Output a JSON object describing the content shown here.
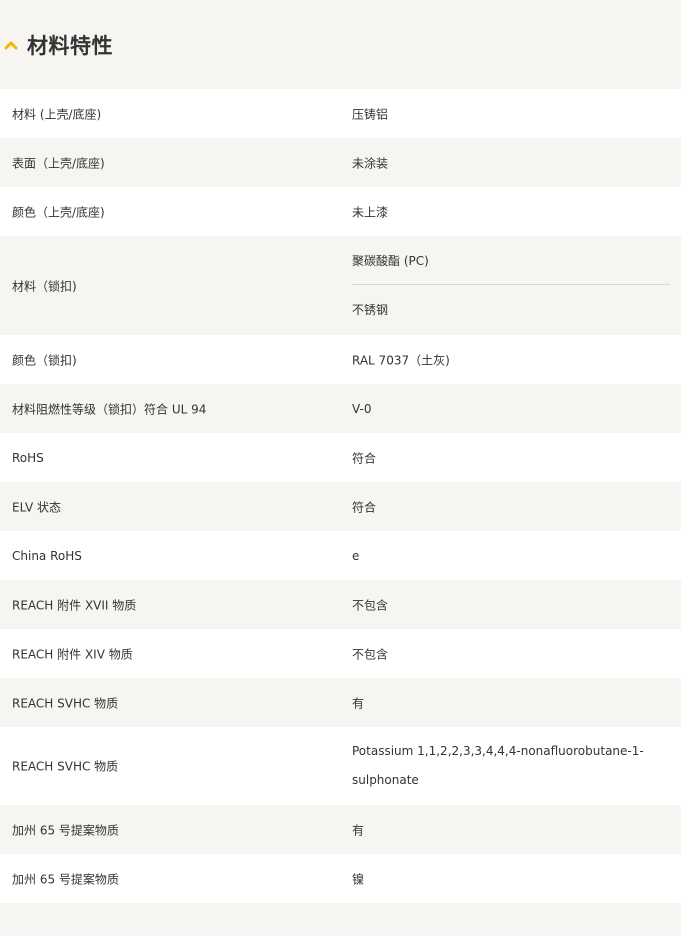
{
  "section": {
    "title": "材料特性",
    "icon": "chevron-up-icon",
    "accent_color": "#f5b800"
  },
  "rows": [
    {
      "label": "材料 (上壳/底座)",
      "value": "压铸铝"
    },
    {
      "label": "表面（上壳/底座)",
      "value": "未涂装"
    },
    {
      "label": "颜色（上壳/底座)",
      "value": "未上漆"
    },
    {
      "label": "材料（锁扣)",
      "values": [
        "聚碳酸酯 (PC)",
        "不锈钢"
      ]
    },
    {
      "label": "颜色（锁扣)",
      "value": "RAL 7037（土灰)"
    },
    {
      "label": "材料阻燃性等级（锁扣）符合 UL 94",
      "value": "V-0"
    },
    {
      "label": "RoHS",
      "value": "符合"
    },
    {
      "label": "ELV 状态",
      "value": "符合"
    },
    {
      "label": "China RoHS",
      "value": "e"
    },
    {
      "label": "REACH 附件 XVII 物质",
      "value": "不包含"
    },
    {
      "label": "REACH 附件 XIV 物质",
      "value": "不包含"
    },
    {
      "label": "REACH SVHC 物质",
      "value": "有"
    },
    {
      "label": "REACH SVHC 物质",
      "value": "Potassium 1,1,2,2,3,3,4,4,4-nonafluorobutane-1-sulphonate"
    },
    {
      "label": "加州 65 号提案物质",
      "value": "有"
    },
    {
      "label": "加州 65 号提案物质",
      "value": "镍"
    }
  ]
}
